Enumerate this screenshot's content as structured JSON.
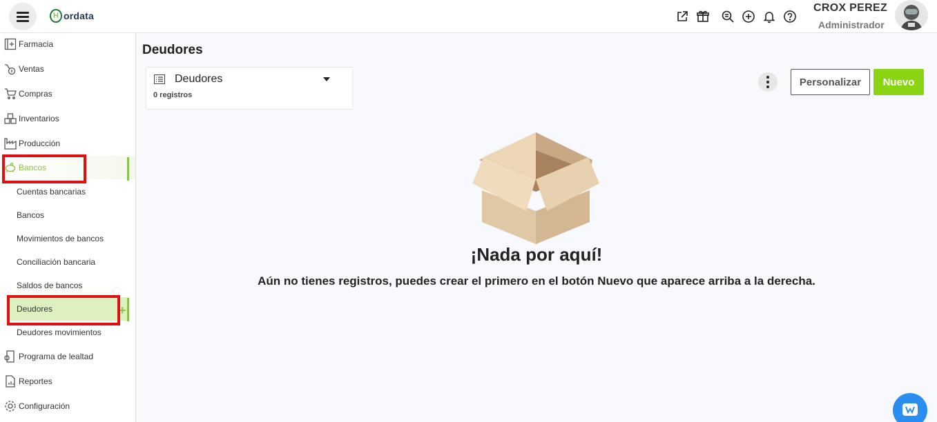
{
  "app": {
    "logo_text": "ordata",
    "logo_mark_letter": "H"
  },
  "topbar": {
    "icons": [
      "external-link-icon",
      "gift-icon",
      "search-doc-icon",
      "plus-circle-icon",
      "bell-icon",
      "help-icon"
    ],
    "user_name": "CROX PEREZ",
    "user_role": "Administrador"
  },
  "sidebar": {
    "items": [
      {
        "label": "Farmacia",
        "icon": "pharmacy-icon"
      },
      {
        "label": "Ventas",
        "icon": "sales-icon"
      },
      {
        "label": "Compras",
        "icon": "cart-icon"
      },
      {
        "label": "Inventarios",
        "icon": "inventory-icon"
      },
      {
        "label": "Producción",
        "icon": "factory-icon"
      },
      {
        "label": "Bancos",
        "icon": "piggy-bank-icon"
      }
    ],
    "bank_sub_items": [
      {
        "label": "Cuentas bancarias"
      },
      {
        "label": "Bancos"
      },
      {
        "label": "Movimientos de bancos"
      },
      {
        "label": "Conciliación bancaria"
      },
      {
        "label": "Saldos de bancos"
      },
      {
        "label": "Deudores"
      },
      {
        "label": "Deudores movimientos"
      }
    ],
    "bottom_items": [
      {
        "label": "Programa de lealtad",
        "icon": "loyalty-icon"
      },
      {
        "label": "Reportes",
        "icon": "report-icon"
      },
      {
        "label": "Configuración",
        "icon": "gear-icon"
      }
    ],
    "plus_glyph": "+"
  },
  "main": {
    "page_title": "Deudores",
    "view_selector": {
      "name": "Deudores",
      "count": "0 registros"
    },
    "buttons": {
      "personalizar": "Personalizar",
      "nuevo": "Nuevo"
    },
    "empty_state": {
      "title": "¡Nada por aquí!",
      "description": "Aún no tienes registros, puedes crear el primero en el botón Nuevo que aparece arriba a la derecha."
    }
  },
  "colors": {
    "accent": "#8bc34a",
    "button_green": "#8bd413",
    "highlight_red": "#e01010",
    "chat_blue": "#2a8df0"
  }
}
